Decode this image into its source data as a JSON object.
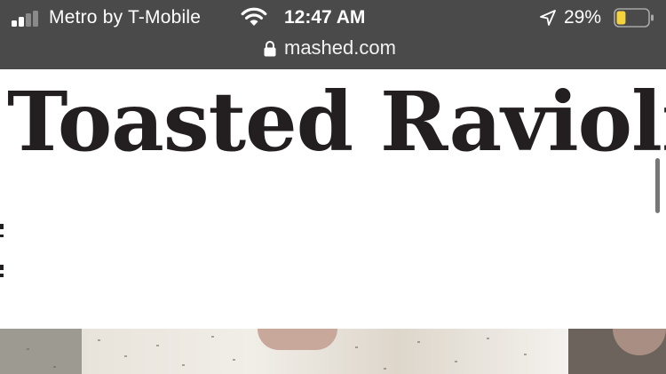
{
  "status_bar": {
    "carrier": "Metro by T-Mobile",
    "time": "12:47 AM",
    "battery_percent": "29%",
    "battery_level": 0.29,
    "icons": [
      "signal-bars-icon",
      "wifi-icon",
      "location-arrow-icon",
      "battery-icon"
    ]
  },
  "address_bar": {
    "domain": "mashed.com",
    "icon": "lock-icon"
  },
  "article": {
    "title": "Toasted Ravioli"
  },
  "colors": {
    "chrome_background": "#4a4a4a",
    "title_text": "#231f20",
    "battery_fill": "#f5d33a"
  }
}
